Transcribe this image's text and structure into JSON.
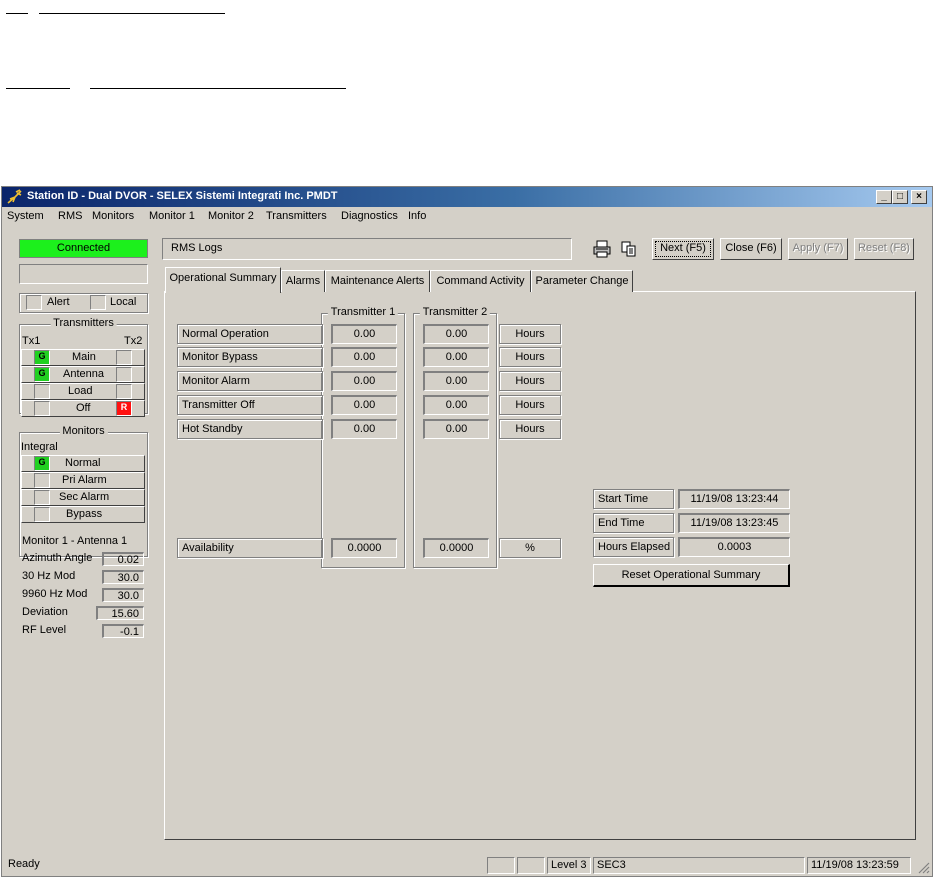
{
  "window": {
    "title": "Station ID - Dual DVOR - SELEX Sistemi Integrati Inc. PMDT",
    "controls": {
      "minimize": "_",
      "maximize": "□",
      "close": "×"
    }
  },
  "menu": [
    "System",
    "RMS",
    "Monitors",
    "Monitor 1",
    "Monitor 2",
    "Transmitters",
    "Diagnostics",
    "Info"
  ],
  "left": {
    "status": "Connected",
    "status_color": "#1cf01c",
    "alert_label": "Alert",
    "local_label": "Local",
    "transmitters": {
      "title": "Transmitters",
      "tx1": "Tx1",
      "tx2": "Tx2",
      "rows": [
        {
          "label": "Main",
          "left": "G",
          "right": ""
        },
        {
          "label": "Antenna",
          "left": "G",
          "right": ""
        },
        {
          "label": "Load",
          "left": "",
          "right": ""
        },
        {
          "label": "Off",
          "left": "",
          "right": "R"
        }
      ]
    },
    "monitors": {
      "title": "Monitors",
      "integral": "Integral",
      "rows": [
        {
          "label": "Normal",
          "ind": "G"
        },
        {
          "label": "Pri Alarm",
          "ind": ""
        },
        {
          "label": "Sec Alarm",
          "ind": ""
        },
        {
          "label": "Bypass",
          "ind": ""
        }
      ],
      "subtitle": "Monitor 1 - Antenna 1",
      "params": [
        {
          "label": "Azimuth Angle",
          "value": "0.02"
        },
        {
          "label": "30 Hz Mod",
          "value": "30.0"
        },
        {
          "label": "9960 Hz Mod",
          "value": "30.0"
        },
        {
          "label": "Deviation",
          "value": "15.60"
        },
        {
          "label": "RF Level",
          "value": "-0.1"
        }
      ]
    }
  },
  "toolbar": {
    "page_title": "RMS Logs",
    "print_icon": "printer-icon",
    "copy_icon": "copy-icon",
    "next": "Next (F5)",
    "close": "Close (F6)",
    "apply": "Apply (F7)",
    "reset": "Reset (F8)"
  },
  "tabs": [
    "Operational Summary",
    "Alarms",
    "Maintenance Alerts",
    "Command Activity",
    "Parameter Change"
  ],
  "summary": {
    "tx1_header": "Transmitter 1",
    "tx2_header": "Transmitter 2",
    "rows": [
      {
        "label": "Normal Operation",
        "tx1": "0.00",
        "tx2": "0.00",
        "unit": "Hours"
      },
      {
        "label": "Monitor Bypass",
        "tx1": "0.00",
        "tx2": "0.00",
        "unit": "Hours"
      },
      {
        "label": "Monitor Alarm",
        "tx1": "0.00",
        "tx2": "0.00",
        "unit": "Hours"
      },
      {
        "label": "Transmitter Off",
        "tx1": "0.00",
        "tx2": "0.00",
        "unit": "Hours"
      },
      {
        "label": "Hot Standby",
        "tx1": "0.00",
        "tx2": "0.00",
        "unit": "Hours"
      }
    ],
    "availability": {
      "label": "Availability",
      "tx1": "0.0000",
      "tx2": "0.0000",
      "unit": "%"
    },
    "start_label": "Start Time",
    "start_value": "11/19/08 13:23:44",
    "end_label": "End Time",
    "end_value": "11/19/08 13:23:45",
    "elapsed_label": "Hours Elapsed",
    "elapsed_value": "0.0003",
    "reset_button": "Reset Operational Summary"
  },
  "status": {
    "text": "Ready",
    "level": "Level 3",
    "user": "SEC3",
    "datetime": "11/19/08 13:23:59"
  }
}
